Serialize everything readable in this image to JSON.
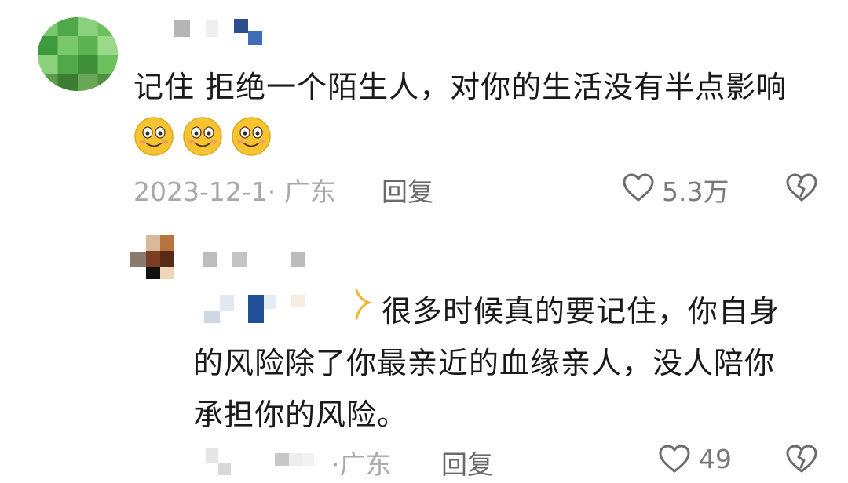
{
  "comment": {
    "text": "记住 拒绝一个陌生人，对你的生活没有半点影响",
    "emojis": [
      "flushed-smile-icon",
      "flushed-smile-icon",
      "flushed-smile-icon"
    ],
    "date_location": "2023-12-1· 广东",
    "reply_label": "回复",
    "likes": "5.3万"
  },
  "reply": {
    "lines": [
      "很多时候真的要记住，你自身",
      "的风险除了你最亲近的血缘亲人，没人陪你",
      "承担你的风险。"
    ],
    "location": "·广东",
    "reply_label": "回复",
    "likes": "49"
  },
  "colors": {
    "primary_text": "#1a1a1a",
    "meta_text": "#a8a8a8",
    "icon": "#6b6b6b"
  }
}
